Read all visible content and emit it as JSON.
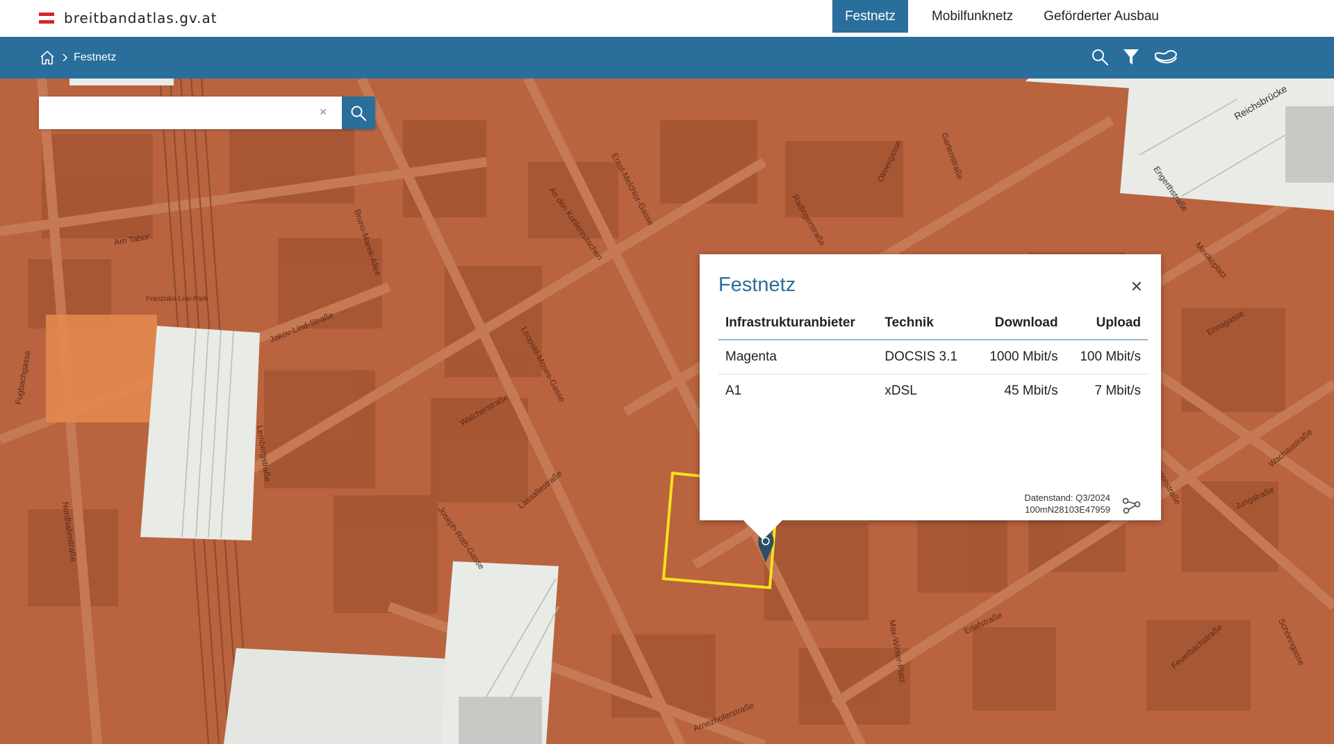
{
  "header": {
    "site_title": "breitbandatlas.gv.at",
    "nav": [
      {
        "label": "Festnetz",
        "active": true
      },
      {
        "label": "Mobilfunknetz",
        "active": false
      },
      {
        "label": "Geförderter Ausbau",
        "active": false
      }
    ]
  },
  "breadcrumb": {
    "current": "Festnetz"
  },
  "toolbar": {
    "icons": [
      "search-icon",
      "filter-icon",
      "map-layers-icon"
    ]
  },
  "search": {
    "value": "",
    "placeholder": ""
  },
  "map": {
    "overlay_color": "#b9633f",
    "highlight_color": "#f5e21a",
    "street_labels": [
      "Am Tabor",
      "Nordbahnstraße",
      "Jakov-Lind-Straße",
      "Bruno-Marek-Allee",
      "Lassallestraße",
      "Leopold-Moses-Gasse",
      "Walcherstraße",
      "Ernst-Melchior-Gasse",
      "Reichsbrücke",
      "Engerthstraße",
      "Joseph-Roth-Gasse",
      "Vorgartenstraße",
      "Mexikoplatz",
      "Jungstraße",
      "Max-Winter-Platz",
      "Lembergstraße",
      "Arnezhoferstraße",
      "Radingerstraße",
      "Ennsgasse",
      "Erlafstraße",
      "Franzisko-Low-Park",
      "Schönngasse",
      "Fugbachgasse",
      "Wachaustraße",
      "Feuerbachstraße",
      "Olmergasse",
      "Gartenstraße",
      "An den Kohlenrutschen"
    ]
  },
  "popup": {
    "title": "Festnetz",
    "columns": [
      "Infrastrukturanbieter",
      "Technik",
      "Download",
      "Upload"
    ],
    "rows": [
      {
        "provider": "Magenta",
        "tech": "DOCSIS 3.1",
        "download": "1000 Mbit/s",
        "upload": "100 Mbit/s"
      },
      {
        "provider": "A1",
        "tech": "xDSL",
        "download": "45 Mbit/s",
        "upload": "7 Mbit/s"
      }
    ],
    "data_status": "Datenstand: Q3/2024",
    "cell_id": "100mN28103E47959"
  }
}
